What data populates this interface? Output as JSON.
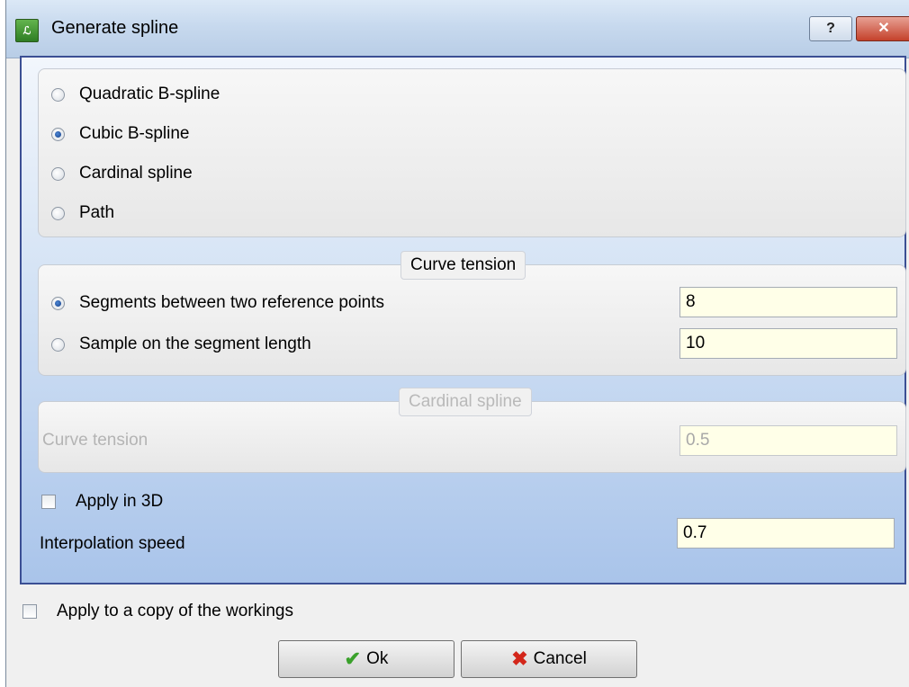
{
  "window": {
    "title": "Generate spline",
    "help_label": "?",
    "close_label": "✕"
  },
  "spline_type": {
    "options": [
      "Quadratic B-spline",
      "Cubic B-spline",
      "Cardinal spline",
      "Path"
    ],
    "selected": "Cubic B-spline"
  },
  "curve_tension": {
    "title": "Curve tension",
    "segments_label": "Segments between two reference points",
    "segments_value": "8",
    "sample_label": "Sample on the segment length",
    "sample_value": "10",
    "selected": "segments"
  },
  "cardinal_spline": {
    "title": "Cardinal spline",
    "tension_label": "Curve tension",
    "tension_value": "0.5"
  },
  "apply_3d": {
    "label": "Apply in 3D",
    "checked": false
  },
  "interpolation": {
    "label": "Interpolation speed",
    "value": "0.7"
  },
  "apply_copy": {
    "label": "Apply to a copy of the workings",
    "checked": false
  },
  "buttons": {
    "ok": "Ok",
    "cancel": "Cancel"
  }
}
